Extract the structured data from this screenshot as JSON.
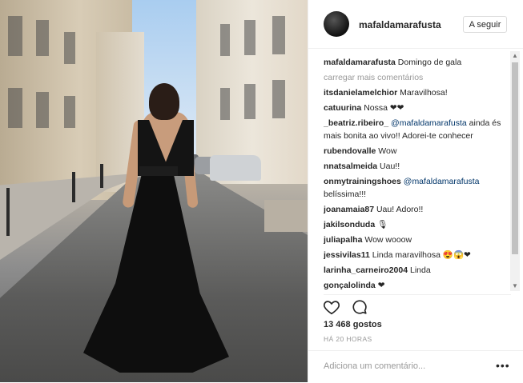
{
  "post": {
    "username": "mafaldamarafusta",
    "follow_label": "A seguir",
    "caption": {
      "user": "mafaldamarafusta",
      "text": "Domingo de gala"
    },
    "load_more": "carregar mais comentários",
    "comments": [
      {
        "user": "itsdanielamelchior",
        "text": "Maravilhosa!"
      },
      {
        "user": "catuurina",
        "text": "Nossa ❤❤"
      },
      {
        "user": "_beatriz.ribeiro_",
        "mention": "@mafaldamarafusta",
        "text": "ainda és mais bonita ao vivo!! Adorei-te conhecer"
      },
      {
        "user": "rubendovalle",
        "text": "Wow"
      },
      {
        "user": "nnatsalmeida",
        "text": "Uau!!"
      },
      {
        "user": "onmytrainingshoes",
        "mention": "@mafaldamarafusta",
        "text": "belíssima!!!"
      },
      {
        "user": "joanamaia87",
        "text": "Uau! Adoro!!"
      },
      {
        "user": "jakilsonduda",
        "text": "🎙"
      },
      {
        "user": "juliapalha",
        "text": "Wow wooow"
      },
      {
        "user": "jessivilas11",
        "text": "Linda maravilhosa 😍😱❤"
      },
      {
        "user": "larinha_carneiro2004",
        "text": "Linda"
      },
      {
        "user": "gonçalolinda",
        "text": "❤"
      }
    ],
    "likes": "13 468 gostos",
    "time": "HÁ 20 HORAS",
    "add_comment_placeholder": "Adiciona um comentário...",
    "more_options": "•••"
  },
  "icons": {
    "like": "heart-outline-icon",
    "comment": "speech-bubble-icon"
  },
  "photo": {
    "description_icon": "photo"
  }
}
